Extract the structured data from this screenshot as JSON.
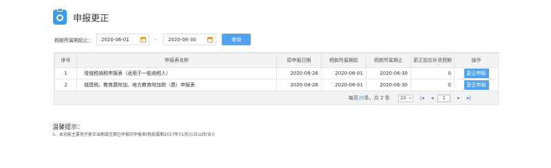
{
  "header": {
    "title": "申报更正"
  },
  "filter": {
    "label": "税款所属期起止：",
    "date_from": "2020-06-01",
    "separator": "-",
    "date_to": "2020-06-30",
    "query_label": "查询"
  },
  "table": {
    "columns": [
      "序号",
      "申报表名称",
      "原申报日期",
      "税款所属期起",
      "税款所属期止",
      "更正前应补退税额",
      "操作"
    ],
    "rows": [
      {
        "index": "1",
        "name": "增值税纳税申报表（适用于一般纳税人）",
        "declare_date": "2020-08-26",
        "period_start": "2020-06-01",
        "period_end": "2020-06-30",
        "amount": "0",
        "action": "更正申报"
      },
      {
        "index": "2",
        "name": "城建税、教育费附加、地方教育附加税（费）申报表",
        "declare_date": "2020-08-26",
        "period_start": "2020-06-01",
        "period_end": "2020-06-30",
        "amount": "0",
        "action": "更正申报"
      }
    ]
  },
  "pager": {
    "prefix": "每页",
    "per_page": "20",
    "mid": "条，共",
    "total": "2",
    "suffix": "条",
    "size_select": "20",
    "current_page": "1"
  },
  "tips": {
    "title": "温馨提示：",
    "text": "1、本功能主要用于更正当期或往期已申报的申报表(税款属期2017年01月01日以后(含))"
  }
}
